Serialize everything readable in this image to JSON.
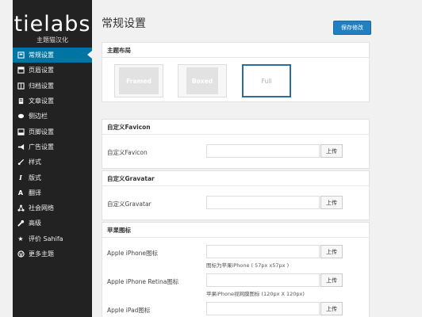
{
  "sidebar": {
    "logo_text": "tielabs",
    "logo_sub": "主题猫汉化",
    "items": [
      {
        "label": "常规设置",
        "icon": "settings-icon",
        "active": true
      },
      {
        "label": "页眉设置",
        "icon": "header-icon"
      },
      {
        "label": "归档设置",
        "icon": "archive-icon"
      },
      {
        "label": "文章设置",
        "icon": "post-icon"
      },
      {
        "label": "侧边栏",
        "icon": "sidebar-icon"
      },
      {
        "label": "页脚设置",
        "icon": "footer-icon"
      },
      {
        "label": "广告设置",
        "icon": "megaphone-icon"
      },
      {
        "label": "样式",
        "icon": "brush-icon"
      },
      {
        "label": "版式",
        "icon": "italic-icon"
      },
      {
        "label": "翻译",
        "icon": "translate-icon"
      },
      {
        "label": "社会网络",
        "icon": "network-icon"
      },
      {
        "label": "高级",
        "icon": "wrench-icon"
      },
      {
        "label": "评价 Sahifa",
        "icon": "star-icon"
      },
      {
        "label": "更多主题",
        "icon": "wordpress-icon"
      }
    ]
  },
  "main": {
    "title": "常规设置",
    "save_label": "保存修改",
    "layout_section": {
      "title": "主题布局",
      "options": [
        {
          "label": "Framed"
        },
        {
          "label": "Boxed"
        },
        {
          "label": "Full",
          "selected": true
        }
      ]
    },
    "favicon_section": {
      "title": "自定义Favicon",
      "field_label": "自定义Favicon",
      "upload_label": "上传"
    },
    "gravatar_section": {
      "title": "自定义Gravatar",
      "field_label": "自定义Gravatar",
      "upload_label": "上传"
    },
    "apple_section": {
      "title": "苹果图标",
      "rows": [
        {
          "label": "Apple iPhone图标",
          "hint": "图标为苹果iPhone ( 57px x57px )",
          "upload_label": "上传"
        },
        {
          "label": "Apple iPhone Retina图标",
          "hint": "苹果iPhone视网膜图标 (120px X 120px)",
          "upload_label": "上传"
        },
        {
          "label": "Apple iPad图标",
          "hint": "",
          "upload_label": "上传"
        }
      ]
    }
  }
}
